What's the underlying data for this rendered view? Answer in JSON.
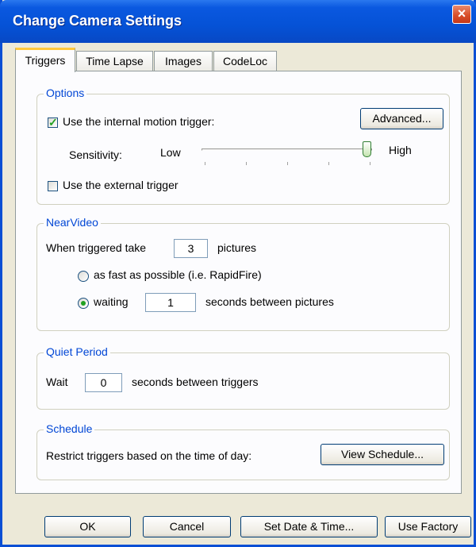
{
  "window": {
    "title": "Change Camera Settings",
    "close_glyph": "×"
  },
  "tabs": [
    {
      "label": "Triggers",
      "active": true
    },
    {
      "label": "Time Lapse",
      "active": false
    },
    {
      "label": "Images",
      "active": false
    },
    {
      "label": "CodeLoc",
      "active": false
    }
  ],
  "options": {
    "label": "Options",
    "internal_trigger_label": "Use the internal motion trigger:",
    "internal_trigger_checked": true,
    "advanced_button": "Advanced...",
    "sensitivity_label": "Sensitivity:",
    "low_label": "Low",
    "high_label": "High",
    "sensitivity_level": 1.0,
    "external_trigger_label": "Use the external trigger",
    "external_trigger_checked": false
  },
  "nearvideo": {
    "label": "NearVideo",
    "when_label": "When triggered take",
    "pictures_value": "3",
    "pictures_label": "pictures",
    "radio_fast_label": "as fast as possible (i.e. RapidFire)",
    "radio_waiting_label": "waiting",
    "waiting_value": "1",
    "seconds_between_label": "seconds between pictures",
    "selected": "waiting"
  },
  "quiet": {
    "label": "Quiet Period",
    "wait_label": "Wait",
    "wait_value": "0",
    "seconds_label": "seconds between triggers"
  },
  "schedule": {
    "label": "Schedule",
    "restrict_label": "Restrict triggers based on the time of day:",
    "view_button": "View Schedule..."
  },
  "footer": {
    "ok": "OK",
    "cancel": "Cancel",
    "set_date": "Set Date & Time...",
    "use_factory": "Use Factory"
  },
  "colors": {
    "title_bar": "#0552d6",
    "group_label": "#0046d5",
    "check_green": "#21a121",
    "close_red": "#d9502a"
  }
}
